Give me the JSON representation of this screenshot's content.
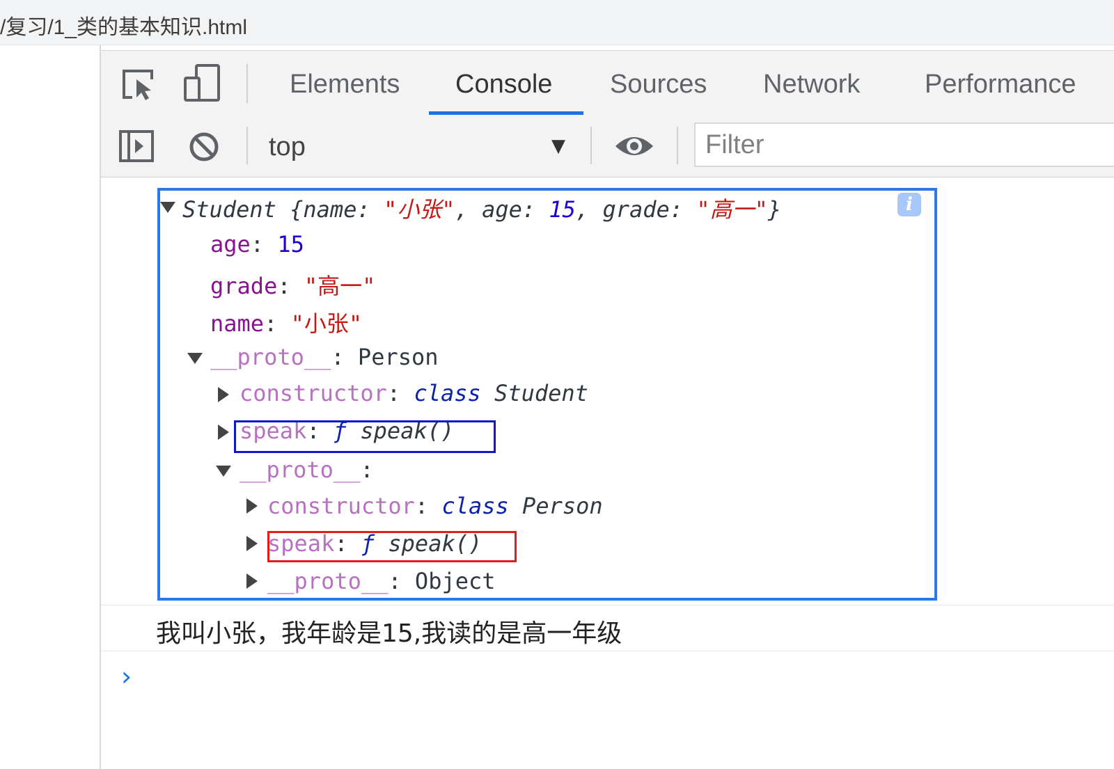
{
  "browser": {
    "url": "/复习/1_类的基本知识.html"
  },
  "devtools": {
    "tabs": [
      {
        "label": "Elements"
      },
      {
        "label": "Console"
      },
      {
        "label": "Sources"
      },
      {
        "label": "Network"
      },
      {
        "label": "Performance"
      }
    ],
    "active_tab": "Console",
    "toolbar": {
      "context": "top",
      "filter_placeholder": "Filter"
    },
    "icons": [
      "inspect-element-icon",
      "device-toolbar-icon",
      "show-sidebar-icon",
      "clear-console-icon",
      "dropdown-arrow-icon",
      "live-expression-eye-icon",
      "info-icon",
      "prompt-chevron-icon"
    ]
  },
  "console": {
    "object_summary": {
      "class_name": "Student",
      "open_brace": "{",
      "k1": "name",
      "v1": "\"小张\"",
      "k2": "age",
      "v2": "15",
      "k3": "grade",
      "v3": "\"高一\"",
      "close_brace": "}",
      "sep_colon": ":",
      "sep_comma": ","
    },
    "props": {
      "age_key": "age",
      "age_val": "15",
      "grade_key": "grade",
      "grade_val": "\"高一\"",
      "name_key": "name",
      "name_val": "\"小张\"",
      "proto_key": "__proto__",
      "proto_val": "Person",
      "colon": ":"
    },
    "proto1": {
      "constructor_key": "constructor",
      "constructor_kw": "class",
      "constructor_name": "Student",
      "speak_key": "speak",
      "speak_f": "ƒ",
      "speak_name": "speak()",
      "proto_key": "__proto__"
    },
    "proto2": {
      "constructor_key": "constructor",
      "constructor_kw": "class",
      "constructor_name": "Person",
      "speak_key": "speak",
      "speak_f": "ƒ",
      "speak_name": "speak()",
      "proto_key": "__proto__",
      "proto_val": "Object"
    },
    "log_message": "我叫小张，我年龄是15,我读的是高一年级",
    "prompt_symbol": "›"
  },
  "colors": {
    "annotation_outer": "#2979e8",
    "annotation_speak_1": "#0a18c8",
    "annotation_speak_2": "#e41b17",
    "active_tab_underline": "#1a73e8"
  }
}
